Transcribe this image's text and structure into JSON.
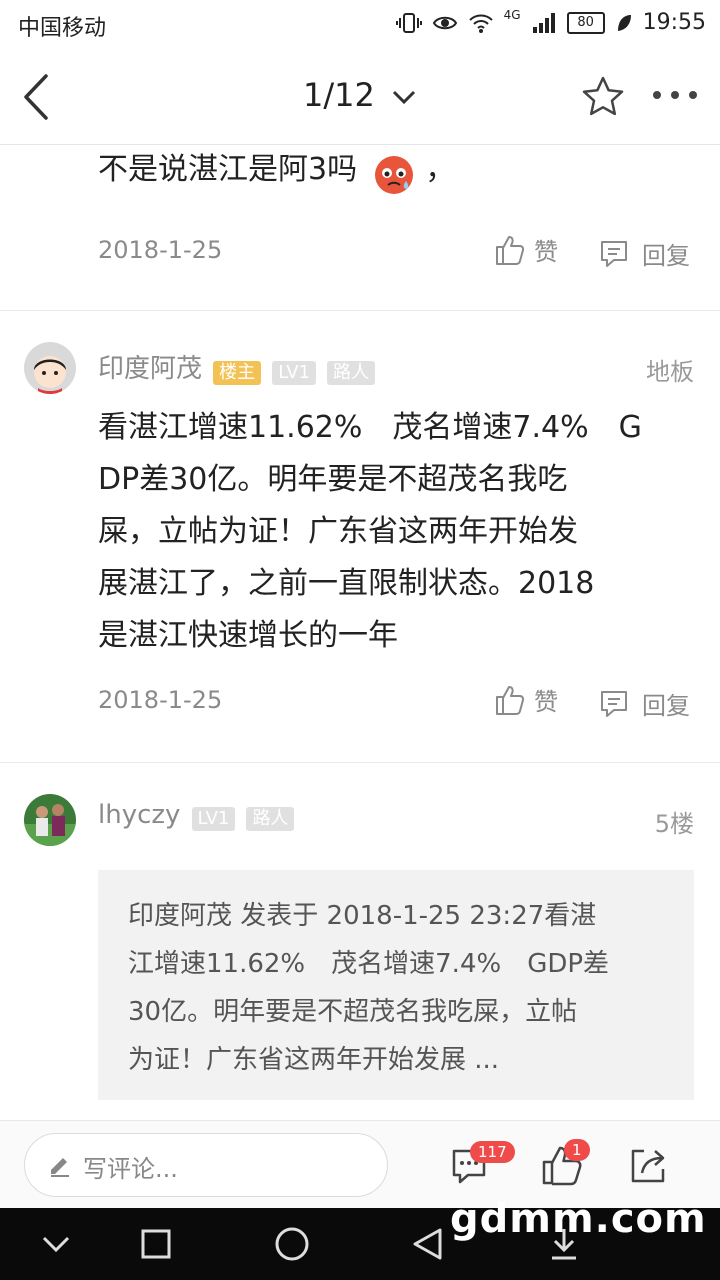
{
  "status_bar": {
    "carrier": "中国移动",
    "network": "4G",
    "battery": "80",
    "time": "19:55"
  },
  "nav": {
    "pager": "1/12",
    "icons": [
      "back-icon",
      "chevron-down-icon",
      "star-icon",
      "more-icon"
    ]
  },
  "posts": [
    {
      "text": "不是说湛江是阿3吗",
      "trailing": "，",
      "date": "2018-1-25",
      "like_label": "赞",
      "reply_label": "回复"
    },
    {
      "username": "印度阿茂",
      "badges": [
        "楼主",
        "LV1",
        "路人"
      ],
      "floor": "地板",
      "lines": [
        "看湛江增速11.62%　茂名增速7.4%　G",
        "DP差30亿。明年要是不超茂名我吃",
        "屎，立帖为证！广东省这两年开始发",
        "展湛江了，之前一直限制状态。2018",
        "是湛江快速增长的一年"
      ],
      "date": "2018-1-25",
      "like_label": "赞",
      "reply_label": "回复"
    },
    {
      "username": "lhyczy",
      "badges": [
        "LV1",
        "路人"
      ],
      "floor": "5楼",
      "quote_lines": [
        "印度阿茂 发表于 2018-1-25 23:27看湛",
        "江增速11.62%　茂名增速7.4%　GDP差",
        "30亿。明年要是不超茂名我吃屎，立帖",
        "为证！广东省这两年开始发展 ..."
      ]
    }
  ],
  "bottom_bar": {
    "comment_placeholder": "写评论...",
    "comment_count": "117",
    "like_count": "1"
  },
  "watermark": "gdmm.com",
  "colors": {
    "host_badge": "#f3c254",
    "count_badge": "#f04b4b",
    "secondary_text": "#8a8a8a"
  }
}
